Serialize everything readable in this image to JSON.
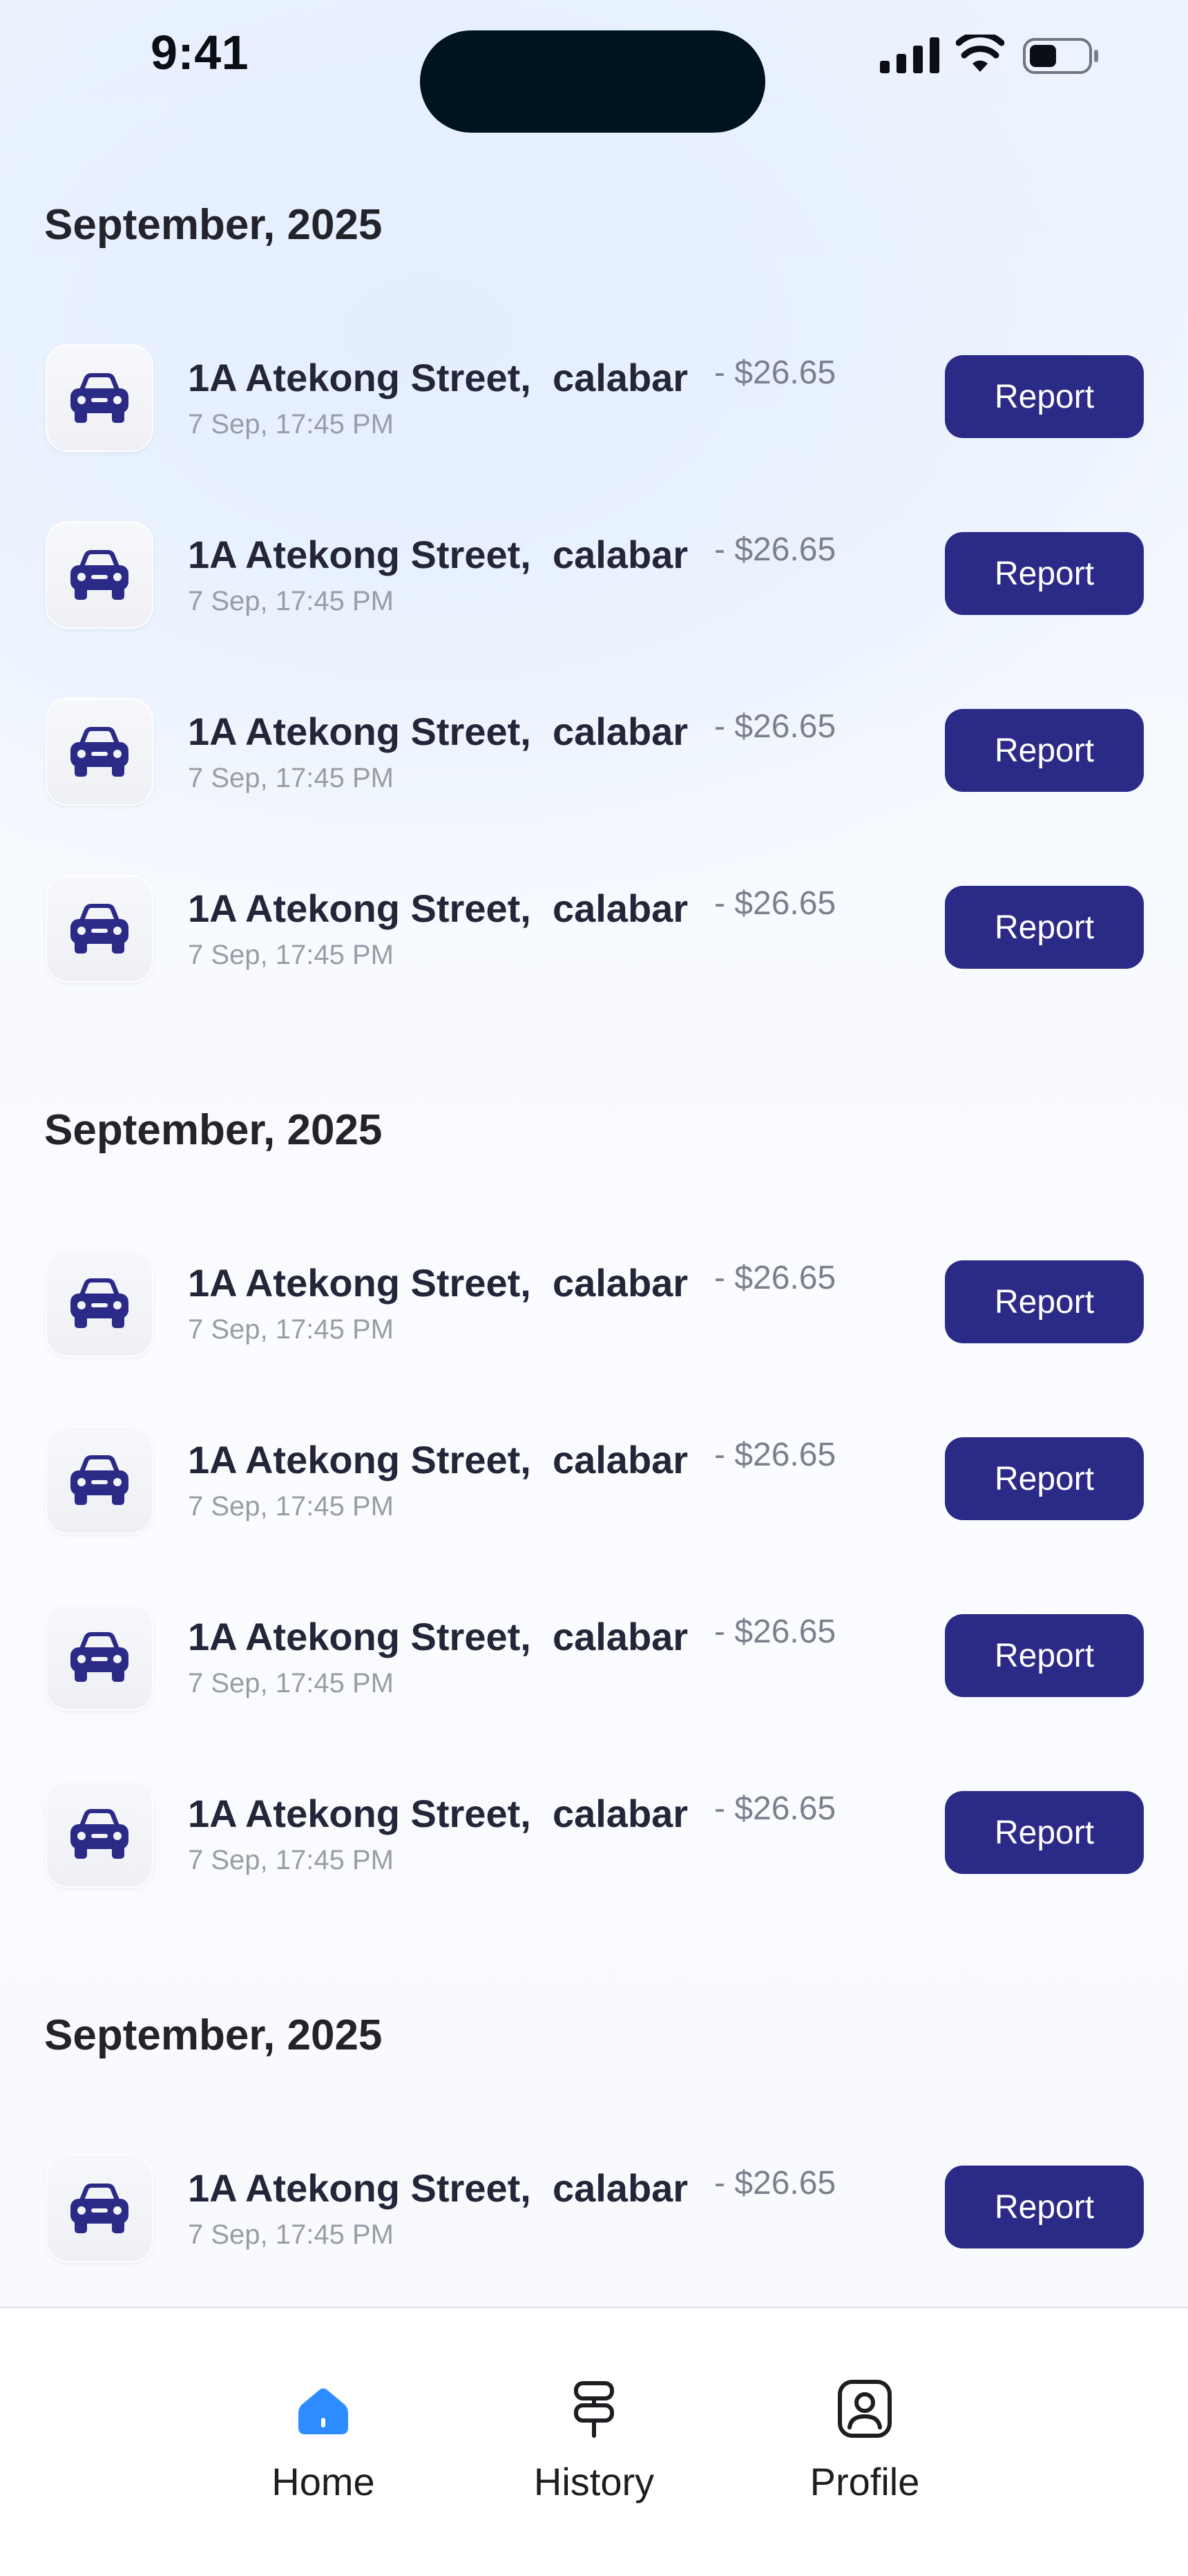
{
  "status_bar": {
    "time": "9:41"
  },
  "colors": {
    "accent": "#2c2a87",
    "home_active": "#2d8cff",
    "text_dark": "#25253a",
    "text_muted": "#9a9ca6"
  },
  "sections": [
    {
      "title": "September, 2025",
      "trips": [
        {
          "address": "1A Atekong Street,  calabar",
          "amount": "- $26.65",
          "date": "7 Sep, 17:45 PM",
          "action": "Report",
          "icon": "car-icon"
        },
        {
          "address": "1A Atekong Street,  calabar",
          "amount": "- $26.65",
          "date": "7 Sep, 17:45 PM",
          "action": "Report",
          "icon": "car-icon"
        },
        {
          "address": "1A Atekong Street,  calabar",
          "amount": "- $26.65",
          "date": "7 Sep, 17:45 PM",
          "action": "Report",
          "icon": "car-icon"
        },
        {
          "address": "1A Atekong Street,  calabar",
          "amount": "- $26.65",
          "date": "7 Sep, 17:45 PM",
          "action": "Report",
          "icon": "car-icon"
        }
      ]
    },
    {
      "title": "September, 2025",
      "trips": [
        {
          "address": "1A Atekong Street,  calabar",
          "amount": "- $26.65",
          "date": "7 Sep, 17:45 PM",
          "action": "Report",
          "icon": "car-icon"
        },
        {
          "address": "1A Atekong Street,  calabar",
          "amount": "- $26.65",
          "date": "7 Sep, 17:45 PM",
          "action": "Report",
          "icon": "car-icon"
        },
        {
          "address": "1A Atekong Street,  calabar",
          "amount": "- $26.65",
          "date": "7 Sep, 17:45 PM",
          "action": "Report",
          "icon": "car-icon"
        },
        {
          "address": "1A Atekong Street,  calabar",
          "amount": "- $26.65",
          "date": "7 Sep, 17:45 PM",
          "action": "Report",
          "icon": "car-icon"
        }
      ]
    },
    {
      "title": "September, 2025",
      "trips": [
        {
          "address": "1A Atekong Street,  calabar",
          "amount": "- $26.65",
          "date": "7 Sep, 17:45 PM",
          "action": "Report",
          "icon": "car-icon"
        }
      ]
    }
  ],
  "bottom_nav": [
    {
      "label": "Home",
      "icon": "home-icon",
      "active": true
    },
    {
      "label": "History",
      "icon": "signpost-icon",
      "active": false
    },
    {
      "label": "Profile",
      "icon": "profile-icon",
      "active": false
    }
  ]
}
